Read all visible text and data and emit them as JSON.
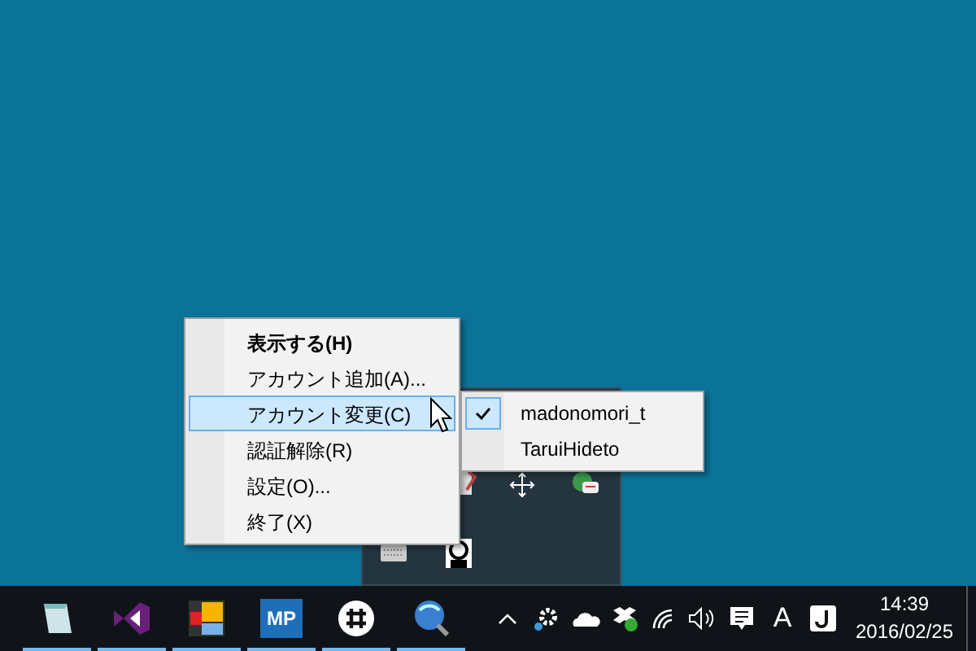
{
  "menu": {
    "items": [
      {
        "label": "表示する(H)",
        "default": true,
        "selected": false
      },
      {
        "label": "アカウント追加(A)...",
        "default": false,
        "selected": false
      },
      {
        "label": "アカウント変更(C)",
        "default": false,
        "selected": true
      },
      {
        "label": "認証解除(R)",
        "default": false,
        "selected": false
      },
      {
        "label": "設定(O)...",
        "default": false,
        "selected": false
      },
      {
        "label": "終了(X)",
        "default": false,
        "selected": false
      }
    ]
  },
  "submenu": {
    "items": [
      {
        "label": "madonomori_t",
        "checked": true
      },
      {
        "label": "TaruiHideto",
        "checked": false
      }
    ]
  },
  "taskbar": {
    "apps": [
      {
        "kind": "notepad",
        "running": true
      },
      {
        "kind": "studio",
        "running": true
      },
      {
        "kind": "tiles",
        "running": true
      },
      {
        "kind": "mp",
        "label": "MP",
        "running": true
      },
      {
        "kind": "slack",
        "running": true
      },
      {
        "kind": "search",
        "running": true
      }
    ],
    "tray": {
      "ime": "A",
      "time": "14:39",
      "date": "2016/02/25"
    }
  }
}
